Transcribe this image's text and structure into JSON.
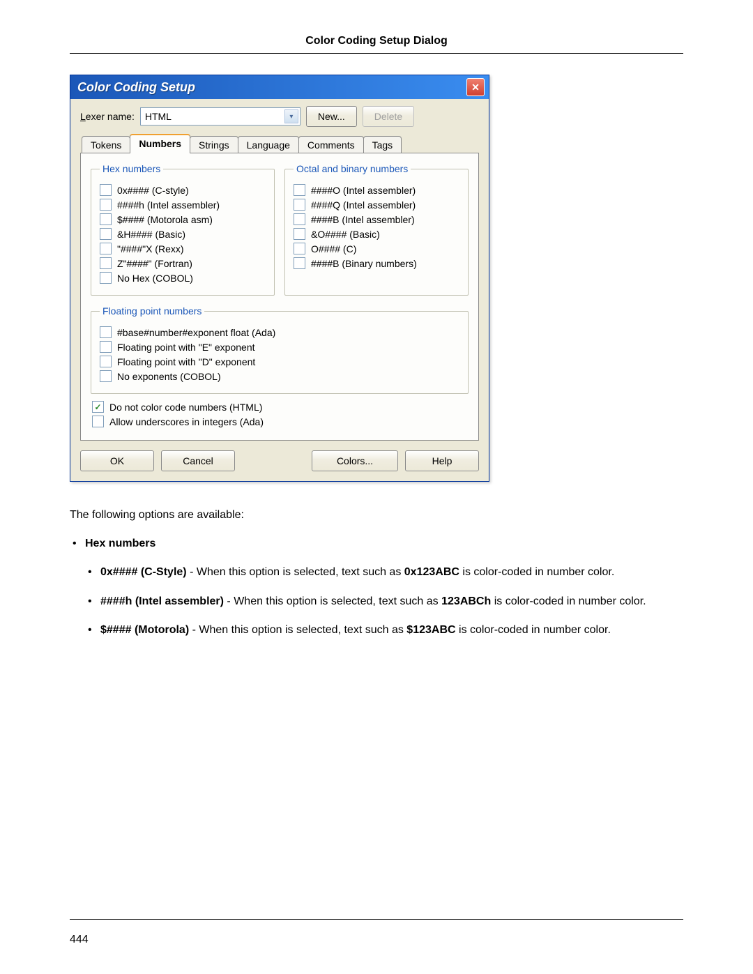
{
  "header": {
    "title": "Color Coding Setup Dialog"
  },
  "dialog": {
    "title": "Color Coding Setup",
    "lexer_label_prefix": "L",
    "lexer_label_rest": "exer name:",
    "lexer_value": "HTML",
    "new_button": "New...",
    "delete_button": "Delete",
    "tabs": [
      {
        "label": "Tokens",
        "active": false
      },
      {
        "label": "Numbers",
        "active": true
      },
      {
        "label": "Strings",
        "active": false
      },
      {
        "label": "Language",
        "active": false
      },
      {
        "label": "Comments",
        "active": false
      },
      {
        "label": "Tags",
        "active": false
      }
    ],
    "hex_group": {
      "legend": "Hex numbers",
      "items": [
        {
          "label": "0x#### (C-style)",
          "checked": false
        },
        {
          "label": "####h (Intel assembler)",
          "checked": false
        },
        {
          "label": "$#### (Motorola asm)",
          "checked": false
        },
        {
          "label": "&H#### (Basic)",
          "checked": false
        },
        {
          "label": "\"####\"X (Rexx)",
          "checked": false
        },
        {
          "label": "Z\"####\" (Fortran)",
          "checked": false
        },
        {
          "label": "No Hex (COBOL)",
          "checked": false
        }
      ]
    },
    "octal_group": {
      "legend": "Octal and binary numbers",
      "items": [
        {
          "label": "####O (Intel assembler)",
          "checked": false
        },
        {
          "label": "####Q (Intel assembler)",
          "checked": false
        },
        {
          "label": "####B (Intel assembler)",
          "checked": false
        },
        {
          "label": "&O#### (Basic)",
          "checked": false
        },
        {
          "label": "O#### (C)",
          "checked": false
        },
        {
          "label": "####B (Binary numbers)",
          "checked": false
        }
      ]
    },
    "float_group": {
      "legend": "Floating point numbers",
      "items": [
        {
          "label": "#base#number#exponent float (Ada)",
          "checked": false
        },
        {
          "label": "Floating point with \"E\" exponent",
          "checked": false
        },
        {
          "label": "Floating point with \"D\" exponent",
          "checked": false
        },
        {
          "label": "No exponents (COBOL)",
          "checked": false
        }
      ]
    },
    "extra_options": [
      {
        "label": "Do not color code numbers (HTML)",
        "checked": true
      },
      {
        "label": "Allow underscores in integers (Ada)",
        "checked": false
      }
    ],
    "buttons": {
      "ok": "OK",
      "cancel": "Cancel",
      "colors": "Colors...",
      "help": "Help"
    }
  },
  "doc": {
    "intro": "The following options are available:",
    "section_title": "Hex numbers",
    "items": [
      {
        "label": "0x#### (C-Style)",
        "body1": " - When this option is selected, text such as ",
        "example": "0x123ABC",
        "body2": " is color-coded in number color."
      },
      {
        "label": "####h (Intel assembler)",
        "body1": " - When this option is selected, text such as ",
        "example": "123ABCh",
        "body2": " is color-coded in number color."
      },
      {
        "label": "$#### (Motorola)",
        "body1": " - When this option is selected, text such as ",
        "example": "$123ABC",
        "body2": " is color-coded in number color."
      }
    ]
  },
  "page_number": "444"
}
